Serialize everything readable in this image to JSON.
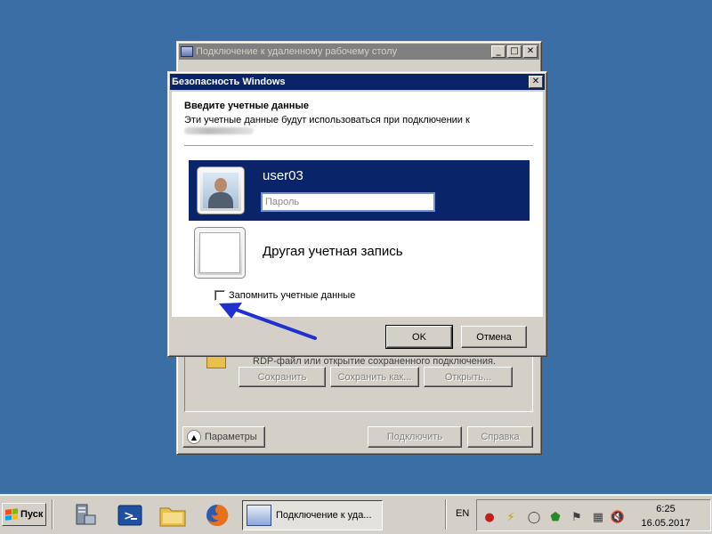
{
  "background_window": {
    "title": "Подключение к удаленному рабочему столу",
    "hint_text": "RDP-файл или открытие сохраненного подключения.",
    "buttons": {
      "save": "Сохранить",
      "save_as": "Сохранить как...",
      "open": "Открыть...",
      "params": "Параметры",
      "connect": "Подключить",
      "help": "Справка"
    }
  },
  "dialog": {
    "title": "Безопасность Windows",
    "heading": "Введите учетные данные",
    "subheading": "Эти учетные данные будут использоваться при подключении к",
    "user_tile": {
      "username": "user03",
      "password_placeholder": "Пароль"
    },
    "other_account_label": "Другая учетная запись",
    "remember_label": "Запомнить учетные данные",
    "remember_checked": false,
    "ok_label": "OK",
    "cancel_label": "Отмена"
  },
  "taskbar": {
    "start_label": "Пуск",
    "active_task_label": "Подключение к уда...",
    "quicklaunch_icons": [
      "server-manager-icon",
      "powershell-icon",
      "explorer-folder-icon",
      "firefox-icon"
    ],
    "language": "EN",
    "clock_time": "6:25",
    "clock_date": "16.05.2017"
  },
  "colors": {
    "desktop": "#3a6ea5",
    "title_active": "#0a246a",
    "selection": "#0a246a",
    "annotation_arrow": "#1f2fd0"
  }
}
